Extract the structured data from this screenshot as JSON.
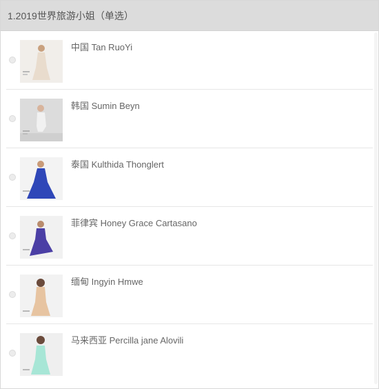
{
  "question": {
    "title": "1.2019世界旅游小姐（单选）"
  },
  "options": [
    {
      "label": "中国 Tan RuoYi",
      "dress_color": "#e9dccd",
      "bg": "#f1eeea"
    },
    {
      "label": "韩国 Sumin Beyn",
      "dress_color": "#ececec",
      "bg": "#dcdcdc"
    },
    {
      "label": "泰国 Kulthida Thonglert",
      "dress_color": "#2f47b8",
      "bg": "#f3f3f3"
    },
    {
      "label": "菲律宾 Honey Grace Cartasano",
      "dress_color": "#4b3fa5",
      "bg": "#f1f1f1"
    },
    {
      "label": "缅甸 Ingyin Hmwe",
      "dress_color": "#e7c4a1",
      "bg": "#f2f2f2"
    },
    {
      "label": "马来西亚 Percilla jane Alovili",
      "dress_color": "#a7e6d6",
      "bg": "#efefef"
    }
  ],
  "colors": {
    "header_bg": "#dcdcdc",
    "text": "#666666",
    "divider": "#e6e6e6"
  }
}
